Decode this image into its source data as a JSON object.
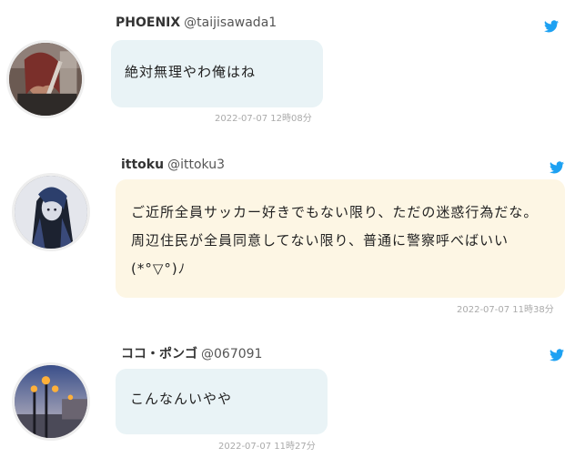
{
  "tweets": [
    {
      "name": "PHOENIX",
      "handle": "@taijisawada1",
      "text": "絶対無理やわ俺はね",
      "timestamp": "2022-07-07 12時08分",
      "bubble_color": "#e9f3f6",
      "avatar_icon": "user-avatar-guitarist"
    },
    {
      "name": "ittoku",
      "handle": "@ittoku3",
      "text": "ご近所全員サッカー好きでもない限り、ただの迷惑行為だな。周辺住民が全員同意してない限り、普通に警察呼べばいい(*°▽°)ﾉ",
      "timestamp": "2022-07-07 11時38分",
      "bubble_color": "#fdf6e4",
      "avatar_icon": "user-avatar-anime-character"
    },
    {
      "name": "ココ・ポンゴ",
      "handle": "@067091",
      "text": "こんなんいやや",
      "timestamp": "2022-07-07 11時27分",
      "bubble_color": "#e9f3f6",
      "avatar_icon": "user-avatar-street-lamps"
    }
  ],
  "colors": {
    "twitter_blue": "#1da1f2"
  }
}
